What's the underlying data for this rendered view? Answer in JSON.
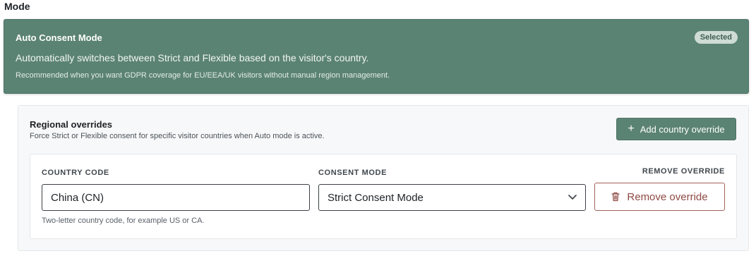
{
  "section": {
    "title": "Mode"
  },
  "auto_mode": {
    "title": "Auto Consent Mode",
    "badge": "Selected",
    "description": "Automatically switches between Strict and Flexible based on the visitor's country.",
    "note": "Recommended when you want GDPR coverage for EU/EEA/UK visitors without manual region management."
  },
  "overrides": {
    "title": "Regional overrides",
    "description": "Force Strict or Flexible consent for specific visitor countries when Auto mode is active.",
    "add_button": "Add country override",
    "add_icon": "plus-icon",
    "row": {
      "country_label": "COUNTRY CODE",
      "country_value": "China (CN)",
      "country_help": "Two-letter country code, for example US or CA.",
      "consent_label": "CONSENT MODE",
      "consent_value": "Strict Consent Mode",
      "consent_icon": "chevron-down-icon",
      "remove_label": "REMOVE OVERRIDE",
      "remove_button": "Remove override",
      "remove_icon": "trash-icon"
    }
  },
  "colors": {
    "accent": "#5b8374",
    "badge_bg": "#cfdcd5",
    "danger": "#8e4a44"
  }
}
